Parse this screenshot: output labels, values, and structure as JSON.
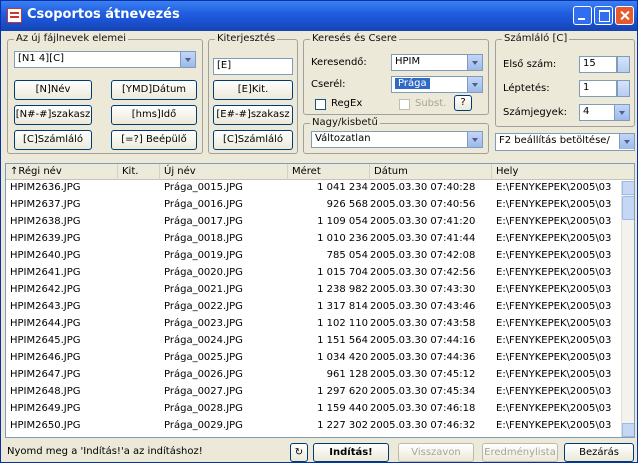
{
  "window": {
    "title": "Csoportos átnevezés"
  },
  "rename_group": {
    "title": "Az új fájlnevek elemei",
    "pattern_value": "[N1 4][C]",
    "buttons": [
      "[N]Név",
      "[YMD]Dátum",
      "[N#-#]szakasz",
      "[hms]Idő",
      "[C]Számláló",
      "[=?] Beépülő"
    ]
  },
  "ext_group": {
    "title": "Kiterjesztés",
    "value": "[E]",
    "buttons": [
      "[E]Kit.",
      "[E#-#]szakasz",
      "[C]Számláló"
    ]
  },
  "search_group": {
    "title": "Keresés és Csere",
    "search_label": "Keresendő:",
    "search_value": "HPIM",
    "replace_label": "Cserél:",
    "replace_value": "Prága",
    "regex_label": "RegEx",
    "subst_label": "Subst.",
    "help_label": "?"
  },
  "case_group": {
    "title": "Nagy/kisbetű",
    "value": "Változatlan"
  },
  "counter_group": {
    "title": "Számláló [C]",
    "start_label": "Első szám:",
    "start_value": "15",
    "step_label": "Léptetés:",
    "step_value": "1",
    "digits_label": "Számjegyek:",
    "digits_value": "4",
    "settings_value": "F2 beállítás betöltése/"
  },
  "list": {
    "columns": [
      "↑Régi név",
      "Kit.",
      "Új név",
      "Méret",
      "Dátum",
      "Hely"
    ],
    "rows": [
      {
        "old": "HPIM2636.JPG",
        "new": "Prága_0015.JPG",
        "size": "1 041 234",
        "date": "2005.03.30 07:40:28",
        "loc": "E:\\FENYKEPEK\\2005\\03"
      },
      {
        "old": "HPIM2637.JPG",
        "new": "Prága_0016.JPG",
        "size": "926 568",
        "date": "2005.03.30 07:40:56",
        "loc": "E:\\FENYKEPEK\\2005\\03"
      },
      {
        "old": "HPIM2638.JPG",
        "new": "Prága_0017.JPG",
        "size": "1 109 054",
        "date": "2005.03.30 07:41:20",
        "loc": "E:\\FENYKEPEK\\2005\\03"
      },
      {
        "old": "HPIM2639.JPG",
        "new": "Prága_0018.JPG",
        "size": "1 010 236",
        "date": "2005.03.30 07:41:44",
        "loc": "E:\\FENYKEPEK\\2005\\03"
      },
      {
        "old": "HPIM2640.JPG",
        "new": "Prága_0019.JPG",
        "size": "785 054",
        "date": "2005.03.30 07:42:08",
        "loc": "E:\\FENYKEPEK\\2005\\03"
      },
      {
        "old": "HPIM2641.JPG",
        "new": "Prága_0020.JPG",
        "size": "1 015 704",
        "date": "2005.03.30 07:42:56",
        "loc": "E:\\FENYKEPEK\\2005\\03"
      },
      {
        "old": "HPIM2642.JPG",
        "new": "Prága_0021.JPG",
        "size": "1 238 982",
        "date": "2005.03.30 07:43:30",
        "loc": "E:\\FENYKEPEK\\2005\\03"
      },
      {
        "old": "HPIM2643.JPG",
        "new": "Prága_0022.JPG",
        "size": "1 317 814",
        "date": "2005.03.30 07:43:46",
        "loc": "E:\\FENYKEPEK\\2005\\03"
      },
      {
        "old": "HPIM2644.JPG",
        "new": "Prága_0023.JPG",
        "size": "1 102 110",
        "date": "2005.03.30 07:43:58",
        "loc": "E:\\FENYKEPEK\\2005\\03"
      },
      {
        "old": "HPIM2645.JPG",
        "new": "Prága_0024.JPG",
        "size": "1 151 564",
        "date": "2005.03.30 07:44:16",
        "loc": "E:\\FENYKEPEK\\2005\\03"
      },
      {
        "old": "HPIM2646.JPG",
        "new": "Prága_0025.JPG",
        "size": "1 034 420",
        "date": "2005.03.30 07:44:36",
        "loc": "E:\\FENYKEPEK\\2005\\03"
      },
      {
        "old": "HPIM2647.JPG",
        "new": "Prága_0026.JPG",
        "size": "961 128",
        "date": "2005.03.30 07:45:12",
        "loc": "E:\\FENYKEPEK\\2005\\03"
      },
      {
        "old": "HPIM2648.JPG",
        "new": "Prága_0027.JPG",
        "size": "1 297 620",
        "date": "2005.03.30 07:45:34",
        "loc": "E:\\FENYKEPEK\\2005\\03"
      },
      {
        "old": "HPIM2649.JPG",
        "new": "Prága_0028.JPG",
        "size": "1 159 440",
        "date": "2005.03.30 07:46:18",
        "loc": "E:\\FENYKEPEK\\2005\\03"
      },
      {
        "old": "HPIM2650.JPG",
        "new": "Prága_0029.JPG",
        "size": "1 227 302",
        "date": "2005.03.30 07:46:32",
        "loc": "E:\\FENYKEPEK\\2005\\03"
      }
    ]
  },
  "footer": {
    "status": "Nyomd meg a 'Indítás!'a az indításhoz!",
    "start_label": "Indítás!",
    "undo_label": "Visszavon",
    "results_label": "Eredménylista",
    "close_label": "Bezárás"
  },
  "colors": {
    "title_bar": "#1f5fe0",
    "highlight": "#316ac5",
    "group_accent": "#e07030"
  }
}
